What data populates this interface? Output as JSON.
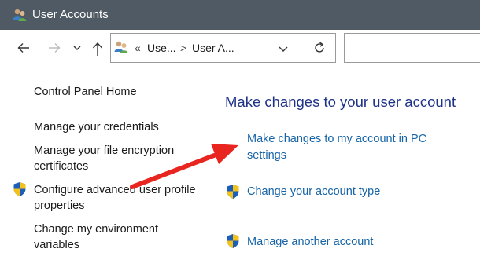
{
  "window": {
    "title": "User Accounts",
    "icon": "users-icon"
  },
  "navigation": {
    "back_icon": "arrow-left-icon",
    "forward_icon": "arrow-right-icon",
    "recent_icon": "chevron-down-icon",
    "up_icon": "arrow-up-icon",
    "address": {
      "icon": "users-icon",
      "overflow": "«",
      "segments": [
        "Use...",
        "User A..."
      ],
      "separator": ">",
      "dropdown_icon": "chevron-down-icon",
      "refresh_icon": "refresh-icon"
    },
    "search_placeholder": ""
  },
  "left_pane": {
    "home": "Control Panel Home",
    "links": [
      {
        "label": "Manage your credentials",
        "icon": ""
      },
      {
        "label": "Manage your file encryption certificates",
        "icon": ""
      },
      {
        "label": "Configure advanced user profile properties",
        "icon": "uac-shield-icon"
      },
      {
        "label": "Change my environment variables",
        "icon": ""
      }
    ]
  },
  "main": {
    "heading": "Make changes to your user account",
    "links": [
      {
        "label": "Make changes to my account in PC settings",
        "icon": ""
      },
      {
        "label": "Change your account type",
        "icon": "uac-shield-icon"
      },
      {
        "label": "Manage another account",
        "icon": "uac-shield-icon"
      }
    ]
  },
  "annotation": {
    "type": "arrow",
    "color": "#e8251f"
  }
}
